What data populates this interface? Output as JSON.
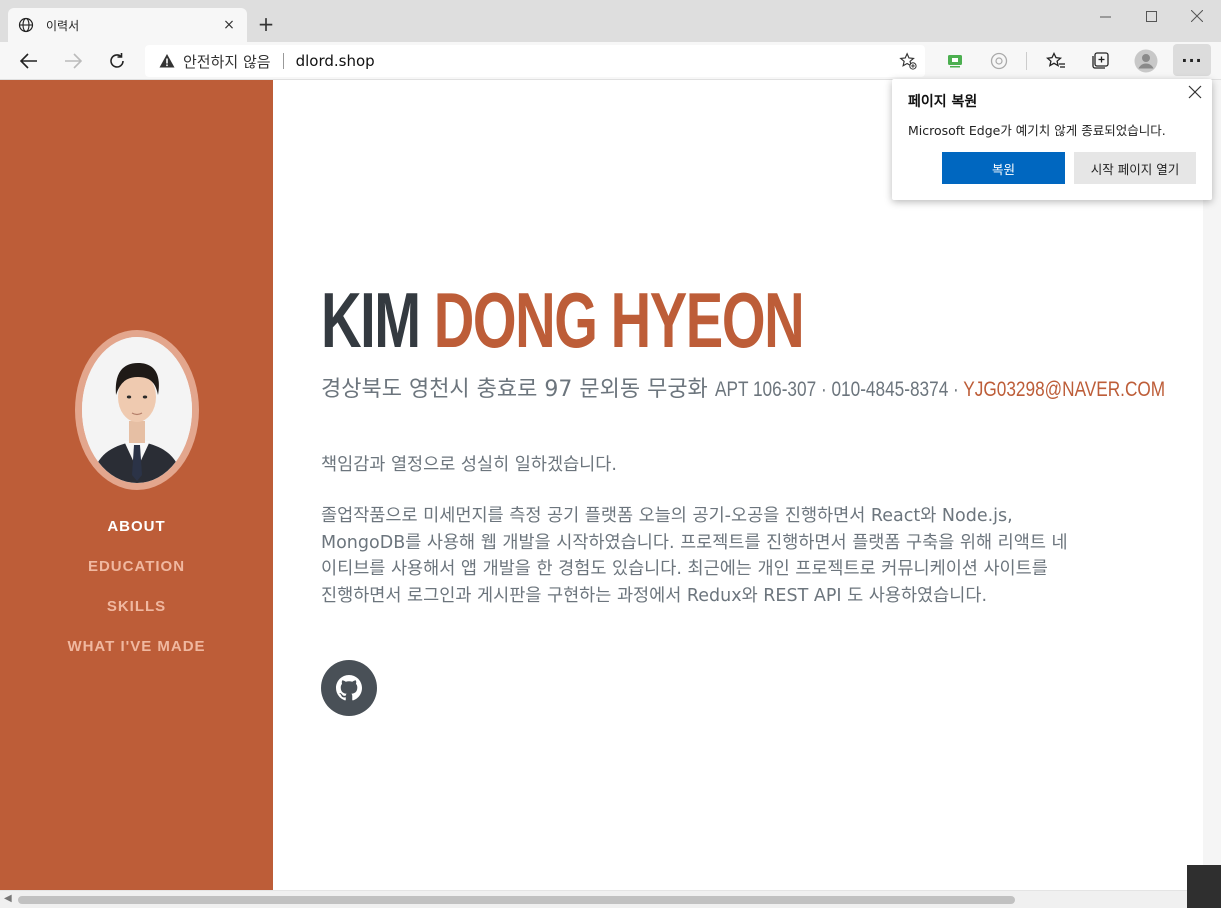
{
  "browser": {
    "tab_title": "이력서",
    "tab_close": "×",
    "new_tab": "+",
    "address": {
      "security_label": "안전하지 않음",
      "url": "dlord.shop"
    },
    "menu_label": "···",
    "window_controls": {
      "minimize": "—",
      "maximize": "☐",
      "close": "✕"
    }
  },
  "sidebar": {
    "accent_color": "#bd5d38",
    "items": [
      {
        "label": "ABOUT",
        "active": true
      },
      {
        "label": "EDUCATION",
        "active": false
      },
      {
        "label": "SKILLS",
        "active": false
      },
      {
        "label": "WHAT I'VE MADE",
        "active": false
      }
    ]
  },
  "main": {
    "first_name": "KIM",
    "last_name": "DONG HYEON",
    "address_korean": "경상북도 영천시 충효로 97 문외동 무궁화",
    "address_latin": "APT 106-307 · 010-4845-8374 · ",
    "email": "YJG03298@NAVER.COM",
    "intro_1": "책임감과 열정으로 성실히 일하겠습니다.",
    "intro_2_lines": [
      "졸업작품으로 미세먼지를 측정 공기 플랫폼 오늘의 공기-오공을 진행하면서 React와 Node.js,",
      "MongoDB를 사용해 웹 개발을 시작하였습니다. 프로젝트를 진행하면서 플랫폼 구축을 위해 리액트 네",
      "이티브를 사용해서 앱 개발을 한 경험도 있습니다. 최근에는 개인 프로젝트로 커뮤니케이션 사이트를",
      "진행하면서 로그인과 게시판을 구현하는 과정에서 Redux와 REST API 도 사용하였습니다."
    ],
    "social_icon": "github-icon"
  },
  "popup": {
    "title": "페이지 복원",
    "message": "Microsoft Edge가 예기치 않게 종료되었습니다.",
    "restore_button": "복원",
    "start_page_button": "시작 페이지 열기",
    "primary_color": "#0067c0"
  }
}
